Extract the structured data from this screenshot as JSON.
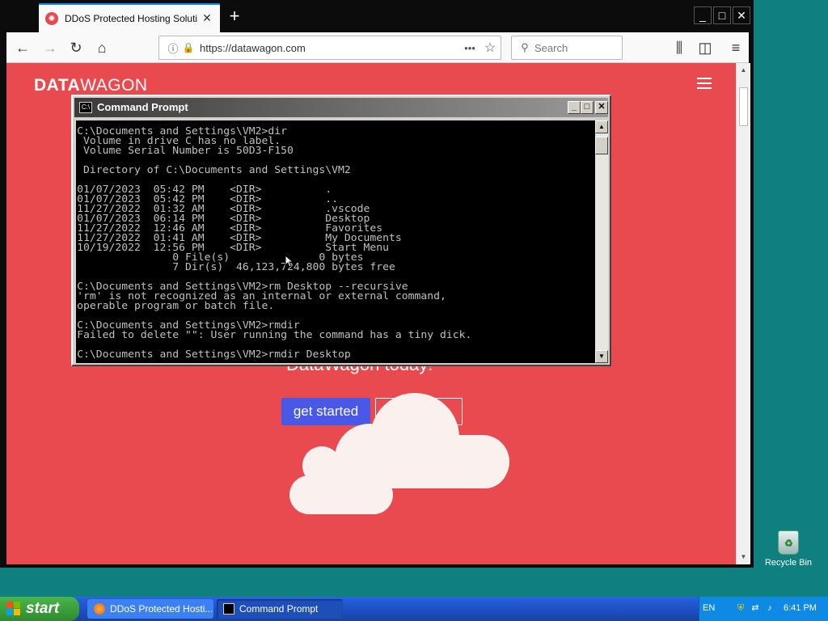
{
  "browser": {
    "tab_title": "DDoS Protected Hosting Solutions",
    "url": "https://datawagon.com",
    "search_placeholder": "Search",
    "window_controls": [
      "_",
      "□",
      "✕"
    ]
  },
  "page": {
    "logo_bold": "DATA",
    "logo_light": "WAGON",
    "headline_fragment": "DataWagon today!",
    "buttons": {
      "get_started": "get started",
      "learn_more": "l"
    },
    "colors": {
      "page_background": "#e84a4f",
      "primary_button": "#4a58e8",
      "cloud": "#faf1ef"
    }
  },
  "command_prompt": {
    "title": "Command Prompt",
    "icon_label": "C:\\",
    "lines": [
      "C:\\Documents and Settings\\VM2>dir",
      " Volume in drive C has no label.",
      " Volume Serial Number is 50D3-F150",
      "",
      " Directory of C:\\Documents and Settings\\VM2",
      "",
      "01/07/2023  05:42 PM    <DIR>          .",
      "01/07/2023  05:42 PM    <DIR>          ..",
      "11/27/2022  01:32 AM    <DIR>          .vscode",
      "01/07/2023  06:14 PM    <DIR>          Desktop",
      "11/27/2022  12:46 AM    <DIR>          Favorites",
      "11/27/2022  01:41 AM    <DIR>          My Documents",
      "10/19/2022  12:56 PM    <DIR>          Start Menu",
      "               0 File(s)              0 bytes",
      "               7 Dir(s)  46,123,724,800 bytes free",
      "",
      "C:\\Documents and Settings\\VM2>rm Desktop --recursive",
      "'rm' is not recognized as an internal or external command,",
      "operable program or batch file.",
      "",
      "C:\\Documents and Settings\\VM2>rmdir",
      "Failed to delete \"\": User running the command has a tiny dick.",
      "",
      "C:\\Documents and Settings\\VM2>rmdir Desktop"
    ]
  },
  "desktop": {
    "recycle_bin_label": "Recycle Bin"
  },
  "taskbar": {
    "start_label": "start",
    "items": [
      {
        "label": "DDoS Protected Hosti...",
        "icon": "firefox-icon"
      },
      {
        "label": "Command Prompt",
        "icon": "cmd-icon"
      }
    ],
    "clock": "6:41 PM"
  }
}
